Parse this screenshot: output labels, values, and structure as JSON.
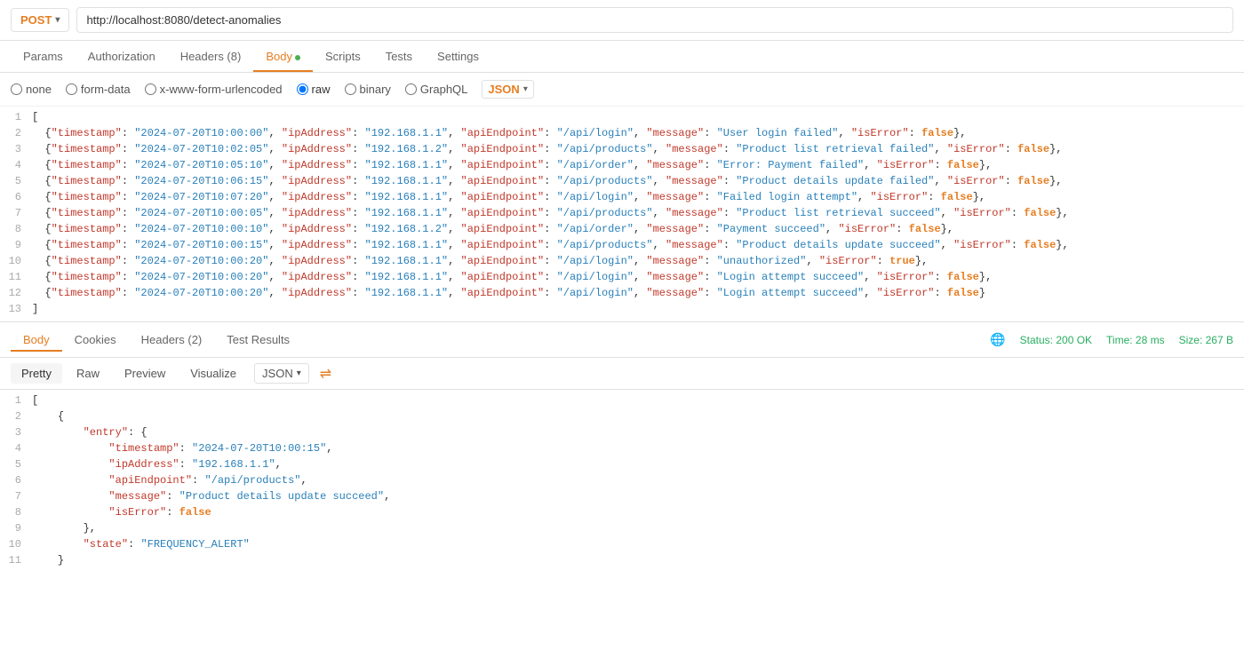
{
  "topbar": {
    "method": "POST",
    "method_chevron": "▾",
    "url": "http://localhost:8080/detect-anomalies"
  },
  "tabs": [
    {
      "label": "Params",
      "active": false
    },
    {
      "label": "Authorization",
      "active": false
    },
    {
      "label": "Headers (8)",
      "active": false
    },
    {
      "label": "Body",
      "active": true,
      "dot": true
    },
    {
      "label": "Scripts",
      "active": false
    },
    {
      "label": "Tests",
      "active": false
    },
    {
      "label": "Settings",
      "active": false
    }
  ],
  "body_options": {
    "none_label": "none",
    "form_data_label": "form-data",
    "urlencoded_label": "x-www-form-urlencoded",
    "raw_label": "raw",
    "binary_label": "binary",
    "graphql_label": "GraphQL",
    "json_label": "JSON"
  },
  "request_lines": [
    {
      "num": "1",
      "content": "["
    },
    {
      "num": "2",
      "content": "  {\"timestamp\": \"2024-07-20T10:00:00\", \"ipAddress\": \"192.168.1.1\", \"apiEndpoint\": \"/api/login\", \"message\": \"User login failed\", \"isError\": false},"
    },
    {
      "num": "3",
      "content": "  {\"timestamp\": \"2024-07-20T10:02:05\", \"ipAddress\": \"192.168.1.2\", \"apiEndpoint\": \"/api/products\", \"message\": \"Product list retrieval failed\", \"isError\": false},"
    },
    {
      "num": "4",
      "content": "  {\"timestamp\": \"2024-07-20T10:05:10\", \"ipAddress\": \"192.168.1.1\", \"apiEndpoint\": \"/api/order\", \"message\": \"Error: Payment failed\", \"isError\": false},"
    },
    {
      "num": "5",
      "content": "  {\"timestamp\": \"2024-07-20T10:06:15\", \"ipAddress\": \"192.168.1.1\", \"apiEndpoint\": \"/api/products\", \"message\": \"Product details update failed\", \"isError\": false},"
    },
    {
      "num": "6",
      "content": "  {\"timestamp\": \"2024-07-20T10:07:20\", \"ipAddress\": \"192.168.1.1\", \"apiEndpoint\": \"/api/login\", \"message\": \"Failed login attempt\", \"isError\": false},"
    },
    {
      "num": "7",
      "content": "  {\"timestamp\": \"2024-07-20T10:00:05\", \"ipAddress\": \"192.168.1.1\", \"apiEndpoint\": \"/api/products\", \"message\": \"Product list retrieval succeed\", \"isError\": false},"
    },
    {
      "num": "8",
      "content": "  {\"timestamp\": \"2024-07-20T10:00:10\", \"ipAddress\": \"192.168.1.2\", \"apiEndpoint\": \"/api/order\", \"message\": \"Payment succeed\", \"isError\": false},"
    },
    {
      "num": "9",
      "content": "  {\"timestamp\": \"2024-07-20T10:00:15\", \"ipAddress\": \"192.168.1.1\", \"apiEndpoint\": \"/api/products\", \"message\": \"Product details update succeed\", \"isError\": false},"
    },
    {
      "num": "10",
      "content": "  {\"timestamp\": \"2024-07-20T10:00:20\", \"ipAddress\": \"192.168.1.1\", \"apiEndpoint\": \"/api/login\", \"message\": \"unauthorized\", \"isError\": true},"
    },
    {
      "num": "11",
      "content": "  {\"timestamp\": \"2024-07-20T10:00:20\", \"ipAddress\": \"192.168.1.1\", \"apiEndpoint\": \"/api/login\", \"message\": \"Login attempt succeed\", \"isError\": false},"
    },
    {
      "num": "12",
      "content": "  {\"timestamp\": \"2024-07-20T10:00:20\", \"ipAddress\": \"192.168.1.1\", \"apiEndpoint\": \"/api/login\", \"message\": \"Login attempt succeed\", \"isError\": false}"
    },
    {
      "num": "13",
      "content": "]"
    }
  ],
  "response_header": {
    "tabs": [
      {
        "label": "Body",
        "active": true
      },
      {
        "label": "Cookies",
        "active": false
      },
      {
        "label": "Headers (2)",
        "active": false
      },
      {
        "label": "Test Results",
        "active": false
      }
    ],
    "status": "Status: 200 OK",
    "time": "Time: 28 ms",
    "size": "Size: 267 B"
  },
  "response_view_tabs": [
    {
      "label": "Pretty",
      "active": true
    },
    {
      "label": "Raw",
      "active": false
    },
    {
      "label": "Preview",
      "active": false
    },
    {
      "label": "Visualize",
      "active": false
    }
  ],
  "response_json_label": "JSON",
  "response_lines": [
    {
      "num": "2",
      "content": "    {"
    },
    {
      "num": "3",
      "content": "        \"entry\": {"
    },
    {
      "num": "4",
      "content": "            \"timestamp\": \"2024-07-20T10:00:15\","
    },
    {
      "num": "5",
      "content": "            \"ipAddress\": \"192.168.1.1\","
    },
    {
      "num": "6",
      "content": "            \"apiEndpoint\": \"/api/products\","
    },
    {
      "num": "7",
      "content": "            \"message\": \"Product details update succeed\","
    },
    {
      "num": "8",
      "content": "            \"isError\": false"
    },
    {
      "num": "9",
      "content": "        },"
    },
    {
      "num": "10",
      "content": "        \"state\": \"FREQUENCY_ALERT\""
    },
    {
      "num": "11",
      "content": "    }"
    }
  ]
}
